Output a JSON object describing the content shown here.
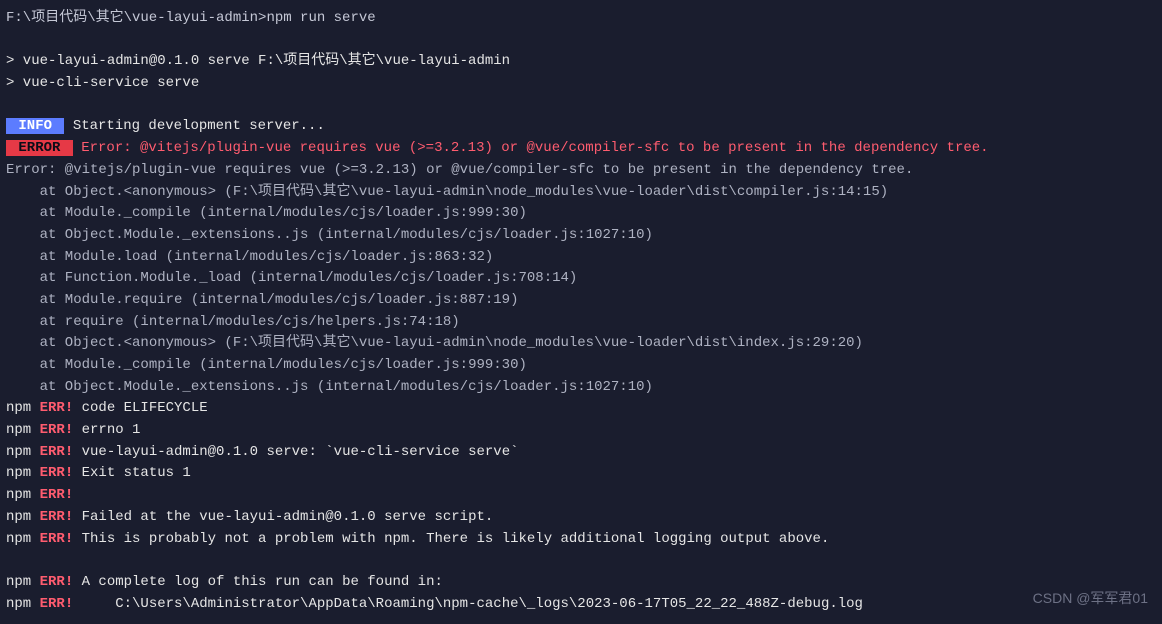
{
  "prompt": {
    "path": "F:\\项目代码\\其它\\vue-layui-admin>",
    "command": "npm run serve"
  },
  "preamble": [
    "> vue-layui-admin@0.1.0 serve F:\\项目代码\\其它\\vue-layui-admin",
    "> vue-cli-service serve"
  ],
  "info": {
    "badge": " INFO ",
    "text": " Starting development server..."
  },
  "error_banner": {
    "badge": " ERROR ",
    "text": " Error: @vitejs/plugin-vue requires vue (>=3.2.13) or @vue/compiler-sfc to be present in the dependency tree."
  },
  "stack": {
    "header": "Error: @vitejs/plugin-vue requires vue (>=3.2.13) or @vue/compiler-sfc to be present in the dependency tree.",
    "frames": [
      "    at Object.<anonymous> (F:\\项目代码\\其它\\vue-layui-admin\\node_modules\\vue-loader\\dist\\compiler.js:14:15)",
      "    at Module._compile (internal/modules/cjs/loader.js:999:30)",
      "    at Object.Module._extensions..js (internal/modules/cjs/loader.js:1027:10)",
      "    at Module.load (internal/modules/cjs/loader.js:863:32)",
      "    at Function.Module._load (internal/modules/cjs/loader.js:708:14)",
      "    at Module.require (internal/modules/cjs/loader.js:887:19)",
      "    at require (internal/modules/cjs/helpers.js:74:18)",
      "    at Object.<anonymous> (F:\\项目代码\\其它\\vue-layui-admin\\node_modules\\vue-loader\\dist\\index.js:29:20)",
      "    at Module._compile (internal/modules/cjs/loader.js:999:30)",
      "    at Object.Module._extensions..js (internal/modules/cjs/loader.js:1027:10)"
    ]
  },
  "npm_errors": [
    {
      "prefix": "npm ",
      "label": "ERR!",
      "msg": " code ELIFECYCLE"
    },
    {
      "prefix": "npm ",
      "label": "ERR!",
      "msg": " errno 1"
    },
    {
      "prefix": "npm ",
      "label": "ERR!",
      "msg": " vue-layui-admin@0.1.0 serve: `vue-cli-service serve`"
    },
    {
      "prefix": "npm ",
      "label": "ERR!",
      "msg": " Exit status 1"
    },
    {
      "prefix": "npm ",
      "label": "ERR!",
      "msg": ""
    },
    {
      "prefix": "npm ",
      "label": "ERR!",
      "msg": " Failed at the vue-layui-admin@0.1.0 serve script."
    },
    {
      "prefix": "npm ",
      "label": "ERR!",
      "msg": " This is probably not a problem with npm. There is likely additional logging output above."
    }
  ],
  "npm_log": [
    {
      "prefix": "npm ",
      "label": "ERR!",
      "msg": " A complete log of this run can be found in:"
    },
    {
      "prefix": "npm ",
      "label": "ERR!",
      "msg": "     C:\\Users\\Administrator\\AppData\\Roaming\\npm-cache\\_logs\\2023-06-17T05_22_22_488Z-debug.log"
    }
  ],
  "watermark": "CSDN @军军君01"
}
